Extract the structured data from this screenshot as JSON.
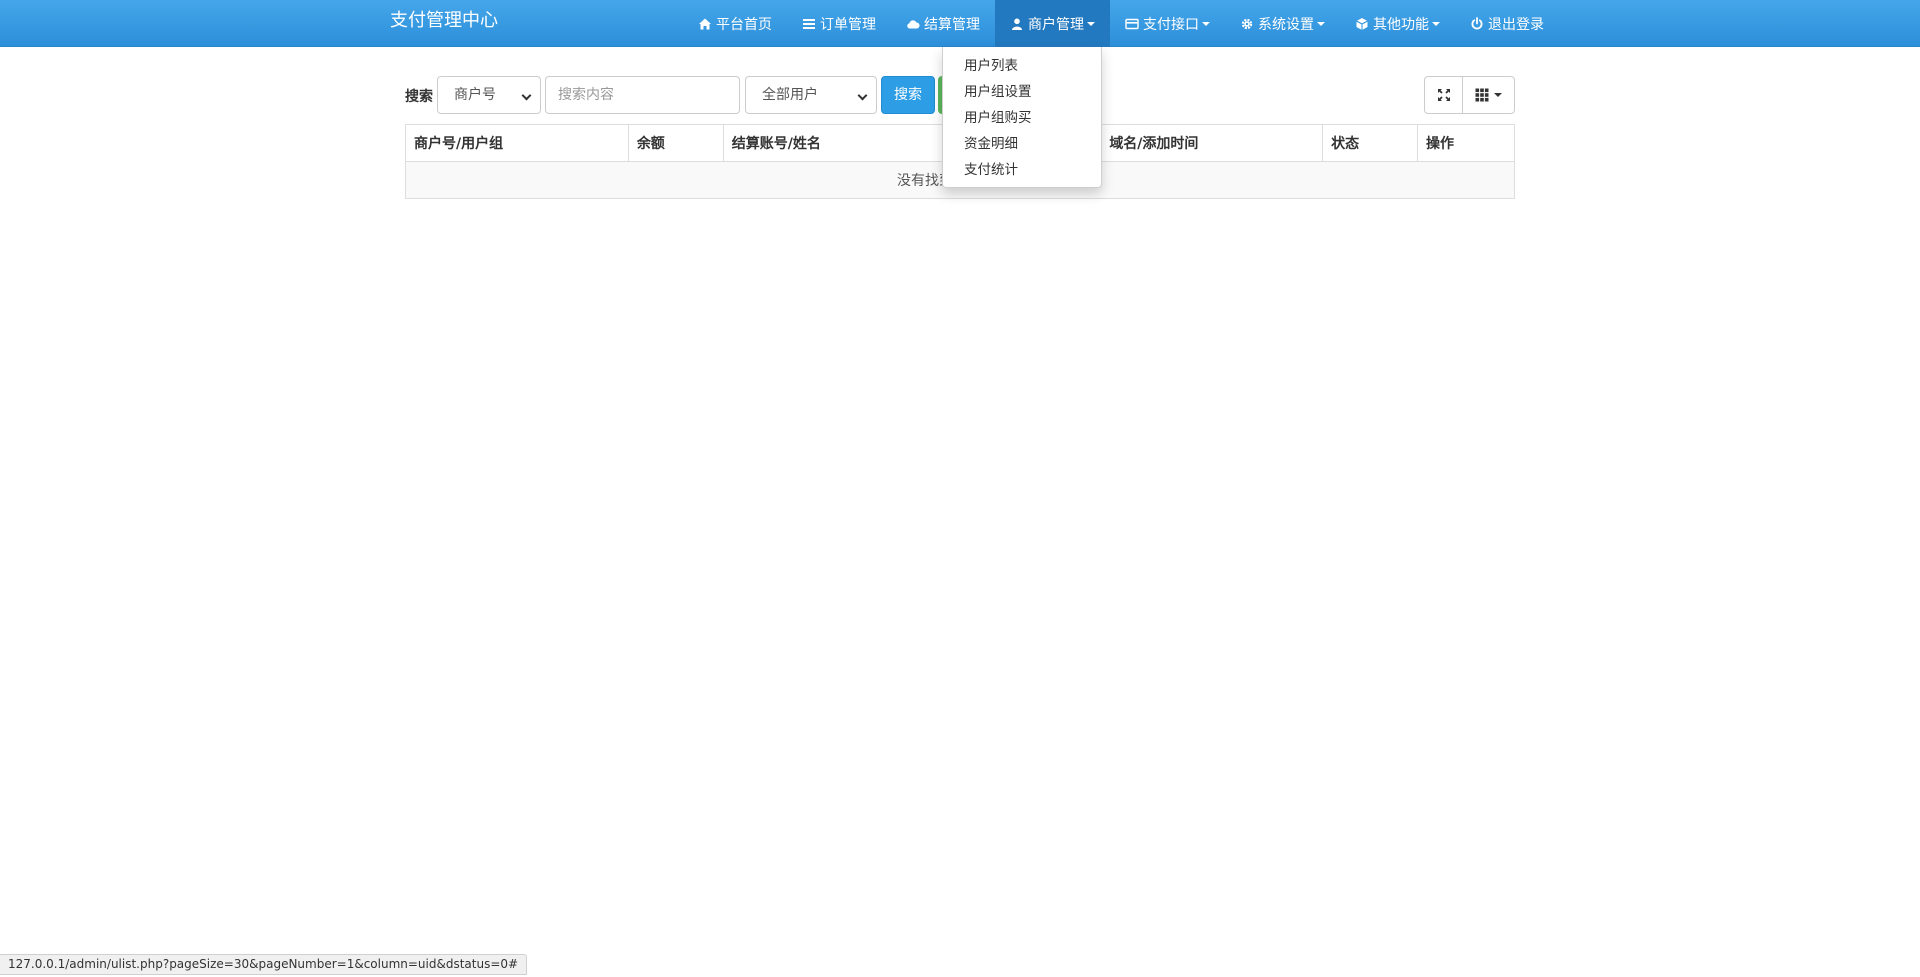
{
  "brand": "支付管理中心",
  "nav": {
    "home": "平台首页",
    "orders": "订单管理",
    "settlement": "结算管理",
    "merchant": "商户管理",
    "payment_api": "支付接口",
    "system": "系统设置",
    "other": "其他功能",
    "logout": "退出登录"
  },
  "merchant_menu": [
    "用户列表",
    "用户组设置",
    "用户组购买",
    "资金明细",
    "支付统计"
  ],
  "toolbar": {
    "search_label": "搜索",
    "field_select": "商户号",
    "search_placeholder": "搜索内容",
    "user_filter": "全部用户",
    "search_button": "搜索"
  },
  "table": {
    "headers": [
      "商户号/用户组",
      "余额",
      "结算账号/姓名",
      "域名/添加时间",
      "状态",
      "操作"
    ],
    "empty_text": "没有找到匹配的记录"
  },
  "status_bar": "127.0.0.1/admin/ulist.php?pageSize=30&pageNumber=1&column=uid&dstatus=0#",
  "colors": {
    "navbar": "#3a9be3",
    "nav_active": "#2379bf",
    "primary_button": "#2d9ee6"
  }
}
